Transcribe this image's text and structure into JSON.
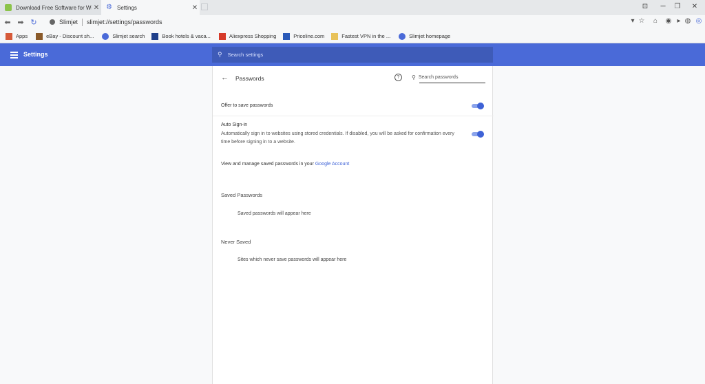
{
  "tabs": [
    {
      "title": "Download Free Software for Wind",
      "close": "✕"
    },
    {
      "title": "Settings",
      "close": "✕"
    }
  ],
  "toolbar": {
    "site_name": "Slimjet",
    "url": "slimjet://settings/passwords"
  },
  "bookmarks": [
    {
      "label": "Apps",
      "color": "#d65a3a"
    },
    {
      "label": "eBay - Discount sh...",
      "color": "#8a5a2a"
    },
    {
      "label": "Slimjet search",
      "color": "#4a6ad8"
    },
    {
      "label": "Book hotels & vaca...",
      "color": "#1f3f8a"
    },
    {
      "label": "Aliexpress Shopping",
      "color": "#d63a2a"
    },
    {
      "label": "Priceline.com",
      "color": "#2a5ab8"
    },
    {
      "label": "Fastest VPN in the ...",
      "color": "#e8c25a"
    },
    {
      "label": "Slimjet homepage",
      "color": "#4a6ad8"
    }
  ],
  "header": {
    "title": "Settings",
    "search_placeholder": "Search settings"
  },
  "passwords": {
    "title": "Passwords",
    "search_placeholder": "Search passwords",
    "offer_label": "Offer to save passwords",
    "offer_enabled": true,
    "autosignin_label": "Auto Sign-in",
    "autosignin_desc": "Automatically sign in to websites using stored credentials. If disabled, you will be asked for confirmation every time before signing in to a website.",
    "autosignin_enabled": true,
    "manage_text": "View and manage saved passwords in your",
    "manage_link": "Google Account",
    "saved_heading": "Saved Passwords",
    "saved_empty": "Saved passwords will appear here",
    "never_heading": "Never Saved",
    "never_empty": "Sites which never save passwords will appear here"
  },
  "colors": {
    "accent": "#4a6ad8",
    "toggle_on": "#3e62d6"
  }
}
